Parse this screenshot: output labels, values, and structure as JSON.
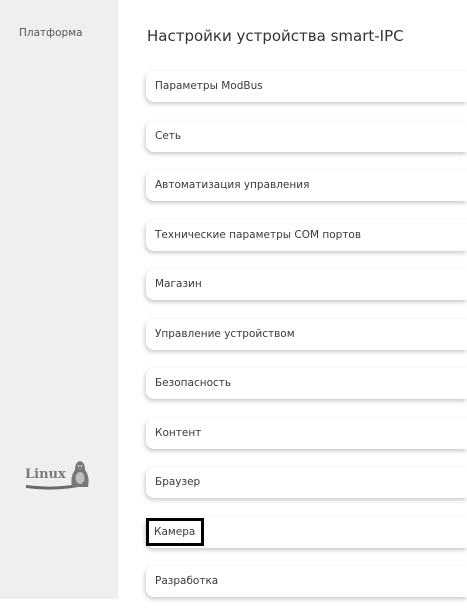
{
  "sidebar": {
    "title": "Платформа",
    "logo_text": "Linux"
  },
  "main": {
    "title": "Настройки устройства smart-IPC",
    "menu": [
      {
        "label": "Параметры ModBus"
      },
      {
        "label": "Сеть"
      },
      {
        "label": "Автоматизация управления"
      },
      {
        "label": "Технические параметры COM портов"
      },
      {
        "label": "Магазин"
      },
      {
        "label": "Управление устройством"
      },
      {
        "label": "Безопасность"
      },
      {
        "label": "Контент"
      },
      {
        "label": "Браузер"
      },
      {
        "label": "Камера",
        "selected": true
      },
      {
        "label": "Разработка"
      }
    ]
  }
}
